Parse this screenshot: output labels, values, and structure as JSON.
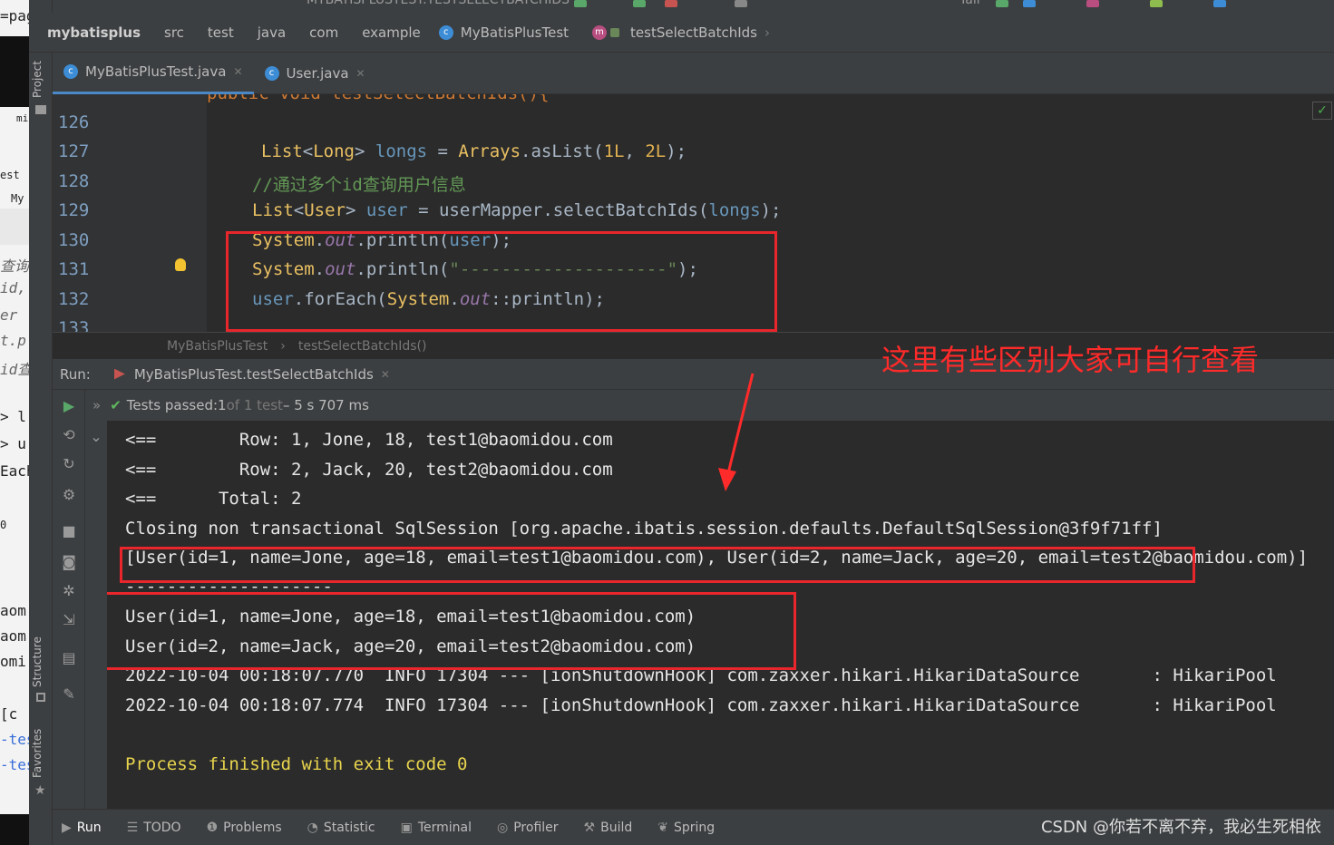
{
  "background_window": {
    "lines": [
      "=pag",
      "mi",
      "est",
      "My",
      "查询用",
      "id,",
      "er",
      "t.p",
      "id查",
      "> l",
      "> u",
      "Each",
      "0",
      "aom",
      "aom",
      "omi",
      "[c",
      "-tes",
      "-tes"
    ]
  },
  "tool_stripe": {
    "project_label": "Project",
    "structure_label": "Structure",
    "favorites_label": "Favorites"
  },
  "top_strip": {
    "title": "MYBATISPLUSTEST.TESTSELECTBATCHIDS",
    "extra": "Tail"
  },
  "navbar": {
    "crumbs": [
      "mybatisplus",
      "src",
      "test",
      "java",
      "com",
      "example"
    ],
    "class_crumb": "MyBatisPlusTest",
    "method_crumb": "testSelectBatchIds"
  },
  "tabs": [
    {
      "label": "MyBatisPlusTest.java"
    },
    {
      "label": "User.java"
    }
  ],
  "editor": {
    "line_numbers": [
      "126",
      "127",
      "128",
      "129",
      "130",
      "131",
      "132",
      "133"
    ],
    "partial_top_line": "public void testSelectBatchIds(){",
    "line127": {
      "t1": "List",
      "t2": "<",
      "t3": "Long",
      "t4": "> ",
      "t5": "longs",
      "t6": " = ",
      "t7": "Arrays",
      "t8": ".asList(",
      "t9": "1L",
      "t10": ", ",
      "t11": "2L",
      "t12": ");"
    },
    "line128": {
      "comment": "//通过多个id查询用户信息"
    },
    "line129": {
      "t1": "List",
      "t2": "<",
      "t3": "User",
      "t4": "> ",
      "t5": "user",
      "t6": " = ",
      "t7": "userMapper",
      "t8": ".selectBatchIds(",
      "t9": "longs",
      "t10": ");"
    },
    "line130": {
      "t1": "System",
      "t2": ".",
      "t3": "out",
      "t4": ".println(",
      "t5": "user",
      "t6": ");"
    },
    "line131": {
      "t1": "System",
      "t2": ".",
      "t3": "out",
      "t4": ".println(",
      "t5": "\"--------------------\"",
      "t6": ");"
    },
    "line132": {
      "t1": "user",
      "t2": ".forEach(",
      "t3": "System",
      "t4": ".",
      "t5": "out",
      "t6": "::println);"
    }
  },
  "editor_breadcrumb": {
    "class": "MyBatisPlusTest",
    "sep": "›",
    "method": "testSelectBatchIds()"
  },
  "run_panel": {
    "label": "Run:",
    "config": "MyBatisPlusTest.testSelectBatchIds",
    "status_prefix": "Tests passed: ",
    "passed": "1",
    "of_text": " of 1 test",
    "duration": " – 5 s 707 ms"
  },
  "annotation": "这里有些区别大家可自行查看",
  "console_lines": [
    "<==        Row: 1, Jone, 18, test1@baomidou.com",
    "<==        Row: 2, Jack, 20, test2@baomidou.com",
    "<==      Total: 2",
    "Closing non transactional SqlSession [org.apache.ibatis.session.defaults.DefaultSqlSession@3f9f71ff]",
    "[User(id=1, name=Jone, age=18, email=test1@baomidou.com), User(id=2, name=Jack, age=20, email=test2@baomidou.com)]",
    "--------------------",
    "User(id=1, name=Jone, age=18, email=test1@baomidou.com)",
    "User(id=2, name=Jack, age=20, email=test2@baomidou.com)",
    "2022-10-04 00:18:07.770  INFO 17304 --- [ionShutdownHook] com.zaxxer.hikari.HikariDataSource       : HikariPool",
    "2022-10-04 00:18:07.774  INFO 17304 --- [ionShutdownHook] com.zaxxer.hikari.HikariDataSource       : HikariPool",
    "",
    "Process finished with exit code 0"
  ],
  "bottom_tabs": [
    {
      "icon": "▶",
      "label": "Run"
    },
    {
      "icon": "☰",
      "label": "TODO"
    },
    {
      "icon": "❶",
      "label": "Problems"
    },
    {
      "icon": "◔",
      "label": "Statistic"
    },
    {
      "icon": "▣",
      "label": "Terminal"
    },
    {
      "icon": "◎",
      "label": "Profiler"
    },
    {
      "icon": "⚒",
      "label": "Build"
    },
    {
      "icon": "❦",
      "label": "Spring"
    }
  ],
  "watermark": "CSDN @你若不离不弃，我必生死相依",
  "colors": {
    "accent": "#4a88c7",
    "highlight_box": "#e8262b",
    "annotation": "#ff2a2a",
    "pass": "#5fb85f",
    "exit_text": "#e8d44d"
  }
}
